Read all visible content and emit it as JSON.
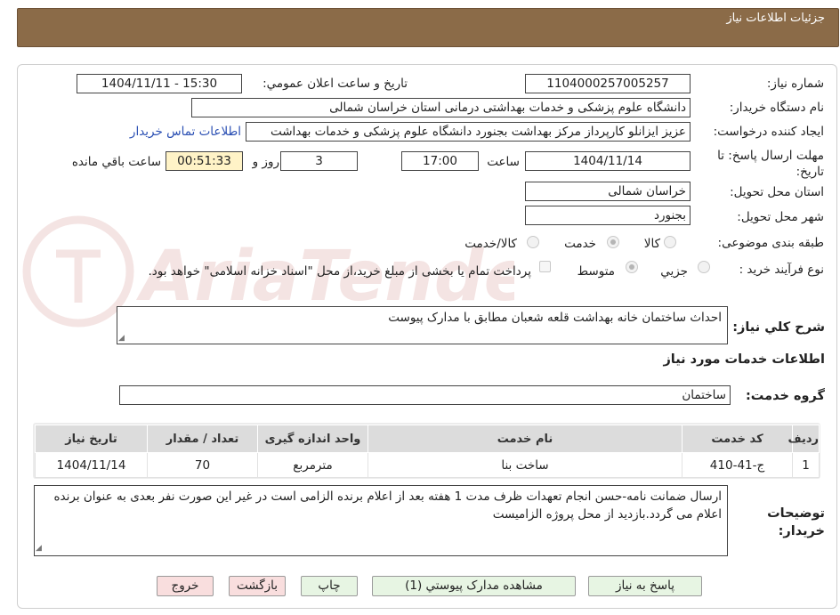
{
  "header": {
    "title": "جزئیات اطلاعات نیاز"
  },
  "fields": {
    "need_number_label": "شماره نیاز:",
    "need_number": "1104000257005257",
    "announce_label": "تاريخ و ساعت اعلان عمومي:",
    "announce_value": "1404/11/11 - 15:30",
    "buyer_org_label": "نام دستگاه خريدار:",
    "buyer_org": "دانشگاه علوم پزشکی و خدمات بهداشتی درمانی استان خراسان شمالی",
    "creator_label": "ايجاد کننده درخواست:",
    "creator": "عزیز ایزانلو کارپرداز مرکز بهداشت بجنورد دانشگاه علوم پزشکی و خدمات بهداشت",
    "contact_link": "اطلاعات تماس خريدار",
    "deadline_label": "مهلت ارسال پاسخ: تا تاریخ:",
    "deadline_date": "1404/11/14",
    "time_label": "ساعت",
    "deadline_time": "17:00",
    "days_value": "3",
    "days_label": "روز و",
    "remaining_time": "00:51:33",
    "remaining_label": "ساعت باقي مانده",
    "province_label": "استان محل تحويل:",
    "province": "خراسان شمالی",
    "city_label": "شهر محل تحويل:",
    "city": "بجنورد",
    "category_label": "طبقه بندی موضوعی:",
    "category_options": [
      "کالا",
      "خدمت",
      "کالا/خدمت"
    ],
    "process_label": "نوع فرآيند خريد :",
    "process_options": [
      "جزيي",
      "متوسط"
    ],
    "payment_note": "پرداخت تمام یا بخشی از مبلغ خرید،از محل \"اسناد خزانه اسلامی\" خواهد بود."
  },
  "description": {
    "label": "شرح کلي نياز:",
    "text": "احداث ساختمان خانه بهداشت قلعه شعبان مطابق با مدارک پیوست"
  },
  "services": {
    "section_title": "اطلاعات خدمات مورد نياز",
    "group_label": "گروه خدمت:",
    "group_value": "ساختمان",
    "columns": [
      "رديف",
      "کد خدمت",
      "نام خدمت",
      "واحد اندازه گيری",
      "تعداد / مقدار",
      "تاريخ نياز"
    ],
    "rows": [
      [
        "1",
        "ج-41-410",
        "ساخت بنا",
        "مترمربع",
        "70",
        "1404/11/14"
      ]
    ]
  },
  "buyer_notes": {
    "label": "توضيحات خريدار:",
    "text": "ارسال ضمانت نامه-حسن انجام تعهدات ظرف مدت 1 هفته بعد از اعلام برنده الزامی است در غیر این صورت نفر بعدی به عنوان برنده اعلام می گردد.بازدید از محل پروژه الزامیست"
  },
  "buttons": {
    "reply": "پاسخ به نياز",
    "attachments": "مشاهده مدارک پيوستي (1)",
    "print": "چاپ",
    "back": "بازگشت",
    "exit": "خروج"
  },
  "watermark": {
    "text": "AriaTender.neT"
  },
  "colors": {
    "header_bg": "#8b6b48",
    "button_green": "#e7f5e3",
    "button_red": "#f9dede",
    "remaining_bg": "#fff3c7",
    "link": "#2a4fb3",
    "watermark": "#b0352e"
  }
}
